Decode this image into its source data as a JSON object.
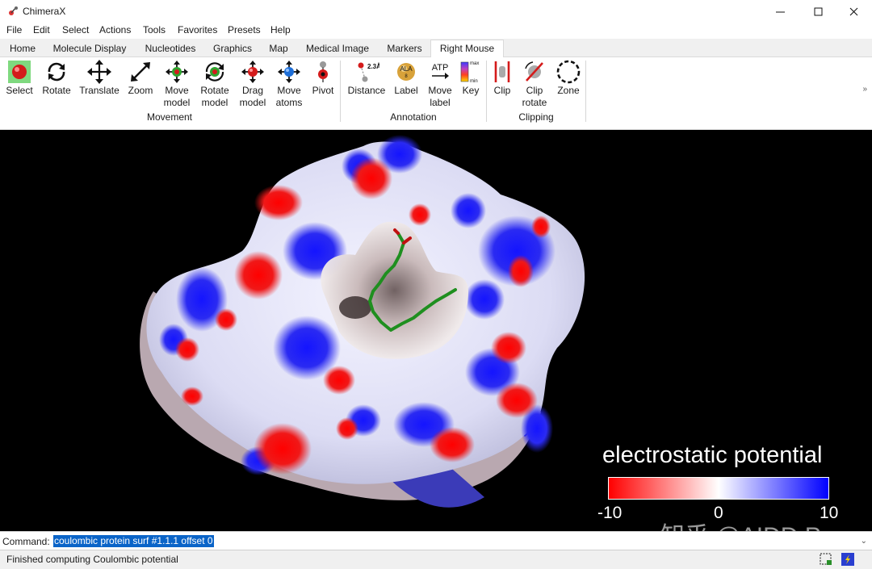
{
  "window": {
    "title": "ChimeraX"
  },
  "menu": {
    "items": [
      {
        "label": "File"
      },
      {
        "label": "Edit"
      },
      {
        "label": "Select"
      },
      {
        "label": "Actions"
      },
      {
        "label": "Tools"
      },
      {
        "label": "Favorites"
      },
      {
        "label": "Presets"
      },
      {
        "label": "Help"
      }
    ]
  },
  "tabs": [
    {
      "label": "Home",
      "active": false
    },
    {
      "label": "Molecule Display",
      "active": false
    },
    {
      "label": "Nucleotides",
      "active": false
    },
    {
      "label": "Graphics",
      "active": false
    },
    {
      "label": "Map",
      "active": false
    },
    {
      "label": "Medical Image",
      "active": false
    },
    {
      "label": "Markers",
      "active": false
    },
    {
      "label": "Right Mouse",
      "active": true
    }
  ],
  "ribbon": {
    "movement": {
      "group_label": "Movement",
      "tools": [
        {
          "line1": "Select",
          "line2": "",
          "icon": "select-icon"
        },
        {
          "line1": "Rotate",
          "line2": "",
          "icon": "rotate-icon"
        },
        {
          "line1": "Translate",
          "line2": "",
          "icon": "translate-icon"
        },
        {
          "line1": "Zoom",
          "line2": "",
          "icon": "zoom-icon"
        },
        {
          "line1": "Move",
          "line2": "model",
          "icon": "move-model-icon"
        },
        {
          "line1": "Rotate",
          "line2": "model",
          "icon": "rotate-model-icon"
        },
        {
          "line1": "Drag",
          "line2": "model",
          "icon": "drag-model-icon"
        },
        {
          "line1": "Move",
          "line2": "atoms",
          "icon": "move-atoms-icon"
        },
        {
          "line1": "Pivot",
          "line2": "",
          "icon": "pivot-icon"
        }
      ]
    },
    "annotation": {
      "group_label": "Annotation",
      "tools": [
        {
          "line1": "Distance",
          "line2": "",
          "icon": "distance-icon",
          "icon_text": "2.3Å"
        },
        {
          "line1": "Label",
          "line2": "",
          "icon": "label-icon",
          "icon_text": "ALA"
        },
        {
          "line1": "Move",
          "line2": "label",
          "icon": "move-label-icon",
          "icon_text": "ATP"
        },
        {
          "line1": "Key",
          "line2": "",
          "icon": "key-icon",
          "icon_text_top": "max",
          "icon_text_bottom": "min"
        }
      ]
    },
    "clipping": {
      "group_label": "Clipping",
      "tools": [
        {
          "line1": "Clip",
          "line2": "",
          "icon": "clip-icon"
        },
        {
          "line1": "Clip",
          "line2": "rotate",
          "icon": "clip-rotate-icon"
        },
        {
          "line1": "Zone",
          "line2": "",
          "icon": "zone-icon"
        }
      ]
    }
  },
  "viewport": {
    "colorkey": {
      "title": "electrostatic potential",
      "min_label": "-10",
      "mid_label": "0",
      "max_label": "10",
      "colors": {
        "min": "#ff0000",
        "mid": "#ffffff",
        "max": "#0000ff"
      }
    },
    "watermark": "知乎 @AIDD Pro"
  },
  "command": {
    "label": "Command:",
    "value": "coulombic protein surf #1.1.1 offset 0"
  },
  "status": {
    "message": "Finished computing Coulombic potential"
  },
  "colors": {
    "selection_highlight": "#0a64c8",
    "ligand_green": "#1f8f1f",
    "background_viewport": "#000000"
  }
}
